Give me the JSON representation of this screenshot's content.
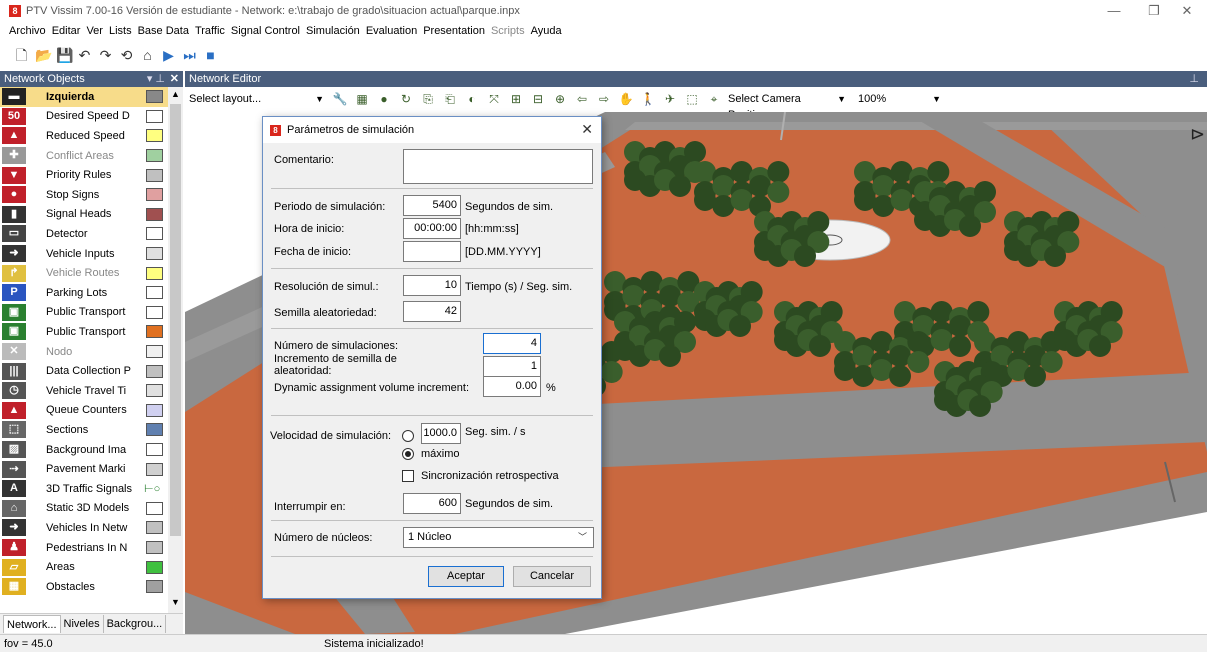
{
  "window": {
    "title": "PTV Vissim 7.00-16 Versión de estudiante - Network: e:\\trabajo de grado\\situacion actual\\parque.inpx",
    "minimize": "—",
    "maximize": "❐",
    "close": "✕"
  },
  "menu": [
    {
      "label": "Archivo",
      "disabled": false
    },
    {
      "label": "Editar",
      "disabled": false
    },
    {
      "label": "Ver",
      "disabled": false
    },
    {
      "label": "Lists",
      "disabled": false
    },
    {
      "label": "Base Data",
      "disabled": false
    },
    {
      "label": "Traffic",
      "disabled": false
    },
    {
      "label": "Signal Control",
      "disabled": false
    },
    {
      "label": "Simulación",
      "disabled": false
    },
    {
      "label": "Evaluation",
      "disabled": false
    },
    {
      "label": "Presentation",
      "disabled": false
    },
    {
      "label": "Scripts",
      "disabled": true
    },
    {
      "label": "Ayuda",
      "disabled": false
    }
  ],
  "toolbar": {
    "icons": [
      "new-file-icon",
      "open-folder-icon",
      "save-icon",
      "undo-icon",
      "redo-icon",
      "rotate-icon",
      "home-icon",
      "play-icon",
      "step-icon",
      "stop-icon"
    ],
    "glyphs": [
      "🗋",
      "📂",
      "💾",
      "↶",
      "↷",
      "⟲",
      "⌂",
      "▶",
      "⏭",
      "■"
    ]
  },
  "network_objects": {
    "header": "Network Objects",
    "pin": "▾ ⊥",
    "close": "✕",
    "items": [
      {
        "label": "Izquierda",
        "icon": "link-icon",
        "glyph": "▬",
        "icon_bg": "#222222",
        "swatch": "#888888",
        "selected": true,
        "disabled": false
      },
      {
        "label": "Desired Speed D",
        "icon": "speed-50-icon",
        "glyph": "50",
        "icon_bg": "#c0202a",
        "swatch": "#ffffff",
        "selected": false,
        "disabled": false
      },
      {
        "label": "Reduced Speed",
        "icon": "warning-triangle-icon",
        "glyph": "▲",
        "icon_bg": "#c0202a",
        "swatch": "#ffff80",
        "selected": false,
        "disabled": false
      },
      {
        "label": "Conflict Areas",
        "icon": "conflict-icon",
        "glyph": "✚",
        "icon_bg": "#999999",
        "swatch": "#a0d0a0",
        "selected": false,
        "disabled": true
      },
      {
        "label": "Priority Rules",
        "icon": "priority-icon",
        "glyph": "▼",
        "icon_bg": "#c0202a",
        "swatch": "#c0c0c0",
        "selected": false,
        "disabled": false
      },
      {
        "label": "Stop Signs",
        "icon": "stop-icon",
        "glyph": "●",
        "icon_bg": "#c0202a",
        "swatch": "#e0a0a0",
        "selected": false,
        "disabled": false
      },
      {
        "label": "Signal Heads",
        "icon": "signal-head-icon",
        "glyph": "▮",
        "icon_bg": "#333333",
        "swatch": "#a05050",
        "selected": false,
        "disabled": false
      },
      {
        "label": "Detector",
        "icon": "detector-icon",
        "glyph": "▭",
        "icon_bg": "#444444",
        "swatch": "#ffffff",
        "selected": false,
        "disabled": false
      },
      {
        "label": "Vehicle Inputs",
        "icon": "vehicle-input-icon",
        "glyph": "➜",
        "icon_bg": "#333333",
        "swatch": "#e0e0e0",
        "selected": false,
        "disabled": false
      },
      {
        "label": "Vehicle Routes",
        "icon": "route-icon",
        "glyph": "↱",
        "icon_bg": "#e0c040",
        "swatch": "#ffff80",
        "selected": false,
        "disabled": true
      },
      {
        "label": "Parking Lots",
        "icon": "parking-icon",
        "glyph": "P",
        "icon_bg": "#2a55c0",
        "swatch": "#ffffff",
        "selected": false,
        "disabled": false
      },
      {
        "label": "Public Transport",
        "icon": "bus-stop-icon",
        "glyph": "▣",
        "icon_bg": "#2a8030",
        "swatch": "#ffffff",
        "selected": false,
        "disabled": false
      },
      {
        "label": "Public Transport",
        "icon": "transit-line-icon",
        "glyph": "▣",
        "icon_bg": "#2a8030",
        "swatch": "#e07020",
        "selected": false,
        "disabled": false
      },
      {
        "label": "Nodo",
        "icon": "node-icon",
        "glyph": "✕",
        "icon_bg": "#bbbbbb",
        "swatch": "#f0f0f0",
        "selected": false,
        "disabled": true
      },
      {
        "label": "Data Collection P",
        "icon": "data-collection-icon",
        "glyph": "|||",
        "icon_bg": "#555555",
        "swatch": "#c0c0c0",
        "selected": false,
        "disabled": false
      },
      {
        "label": "Vehicle Travel Ti",
        "icon": "stopwatch-icon",
        "glyph": "◷",
        "icon_bg": "#555555",
        "swatch": "#e0e0e0",
        "selected": false,
        "disabled": false
      },
      {
        "label": "Queue Counters",
        "icon": "queue-counter-icon",
        "glyph": "▲",
        "icon_bg": "#c0202a",
        "swatch": "#d0d0f0",
        "selected": false,
        "disabled": false
      },
      {
        "label": "Sections",
        "icon": "section-icon",
        "glyph": "⬚",
        "icon_bg": "#666666",
        "swatch": "#6080b0",
        "selected": false,
        "disabled": false
      },
      {
        "label": "Background Ima",
        "icon": "background-image-icon",
        "glyph": "▨",
        "icon_bg": "#555555",
        "swatch": "#ffffff",
        "selected": false,
        "disabled": false
      },
      {
        "label": "Pavement Marki",
        "icon": "pavement-marking-icon",
        "glyph": "⇢",
        "icon_bg": "#555555",
        "swatch": "#d0d0d0",
        "selected": false,
        "disabled": false
      },
      {
        "label": "3D Traffic Signals",
        "icon": "traffic-signal-3d-icon",
        "glyph": "A",
        "icon_bg": "#333333",
        "swatch": "#ffffff",
        "selected": false,
        "disabled": false
      },
      {
        "label": "Static 3D Models",
        "icon": "static-model-icon",
        "glyph": "⌂",
        "icon_bg": "#666666",
        "swatch": "#ffffff",
        "selected": false,
        "disabled": false
      },
      {
        "label": "Vehicles In Netw",
        "icon": "vehicle-icon",
        "glyph": "➜",
        "icon_bg": "#333333",
        "swatch": "#c0c0c0",
        "selected": false,
        "disabled": false
      },
      {
        "label": "Pedestrians In N",
        "icon": "pedestrian-icon",
        "glyph": "♟",
        "icon_bg": "#c0202a",
        "swatch": "#c0c0c0",
        "selected": false,
        "disabled": false
      },
      {
        "label": "Areas",
        "icon": "area-icon",
        "glyph": "▱",
        "icon_bg": "#e0b020",
        "swatch": "#40c040",
        "selected": false,
        "disabled": false
      },
      {
        "label": "Obstacles",
        "icon": "obstacle-icon",
        "glyph": "▦",
        "icon_bg": "#e0b020",
        "swatch": "#a0a0a0",
        "selected": false,
        "disabled": false
      }
    ],
    "connector_glyph": "⊢○",
    "tabs": [
      "Network...",
      "Niveles",
      "Backgrou..."
    ]
  },
  "network_editor": {
    "header": "Network Editor",
    "layout_placeholder": "Select layout...",
    "camera_placeholder": "Select Camera Position...",
    "zoom": "100%",
    "icons": [
      "wrench-icon",
      "grid-icon",
      "globe-icon",
      "rotate-3d-icon",
      "copy-icon",
      "clipboard-icon",
      "color-icon",
      "select-icon",
      "zoom-box-icon",
      "zoom-all-icon",
      "zoom-in-icon",
      "arrow-left-icon",
      "arrow-right-icon",
      "pan-icon",
      "walk-icon",
      "fly-icon",
      "3d-mode-icon",
      "camera-icon"
    ],
    "glyphs": [
      "🔧",
      "▦",
      "●",
      "↻",
      "⎘",
      "⎗",
      "◐",
      "⤧",
      "⊞",
      "⊟",
      "⊕",
      "⇦",
      "⇨",
      "✋",
      "🚶",
      "✈",
      "⬚",
      "⌖"
    ]
  },
  "colors": {
    "plaza": "#c9683f",
    "road": "#8e8e8e",
    "tree": "#2c4a21",
    "accent": "#4a5e7d"
  },
  "status": {
    "fov": "fov = 45.0",
    "message": "Sistema inicializado!"
  },
  "dialog": {
    "title": "Parámetros de simulación",
    "close": "✕",
    "comentario_label": "Comentario:",
    "comentario_value": "",
    "periodo_label": "Periodo de simulación:",
    "periodo_value": "5400",
    "periodo_unit": "Segundos de sim.",
    "hora_label": "Hora de inicio:",
    "hora_value": "00:00:00",
    "hora_unit": "[hh:mm:ss]",
    "fecha_label": "Fecha de inicio:",
    "fecha_value": "",
    "fecha_unit": "[DD.MM.YYYY]",
    "resolucion_label": "Resolución de simul.:",
    "resolucion_value": "10",
    "resolucion_unit": "Tiempo (s) / Seg. sim.",
    "semilla_label": "Semilla aleatoriedad:",
    "semilla_value": "42",
    "num_sim_label": "Número de simulaciones:",
    "num_sim_value": "4",
    "incremento_label_1": "Incremento de semilla de",
    "incremento_label_2": "aleatoridad:",
    "incremento_value": "1",
    "dyn_label": "Dynamic assignment volume increment:",
    "dyn_value": "0.00",
    "dyn_unit": "%",
    "velocidad_label": "Velocidad de simulación:",
    "velocidad_value": "1000.0",
    "velocidad_unit": "Seg. sim. / s",
    "maximo_label": "máximo",
    "maximo_selected": true,
    "sincronizacion_label": "Sincronización retrospectiva",
    "sincronizacion_checked": false,
    "interrumpir_label": "Interrumpir en:",
    "interrumpir_value": "600",
    "interrumpir_unit": "Segundos de sim.",
    "nucleos_label": "Número de núcleos:",
    "nucleos_value": "1 Núcleo",
    "ok": "Aceptar",
    "cancel": "Cancelar"
  }
}
